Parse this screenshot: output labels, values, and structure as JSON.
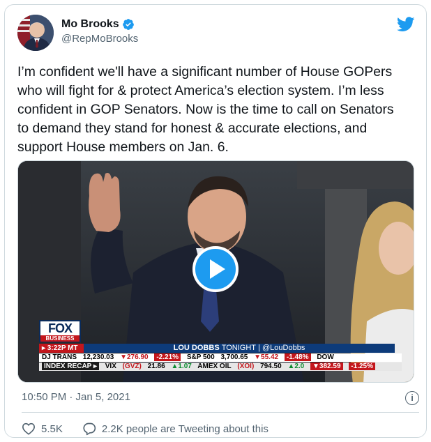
{
  "author": {
    "name": "Mo Brooks",
    "handle": "@RepMoBrooks",
    "verified": true
  },
  "tweet": {
    "text": "I’m confident we'll have a significant number of House GOPers who will fight for & protect America’s election system. I’m less confident in GOP Senators. Now is the time to call on Senators to demand they stand for honest & accurate elections, and support House members on Jan. 6.",
    "timestamp": "10:50 PM · Jan 5, 2021"
  },
  "video": {
    "chyron": {
      "logo_top": "FOX",
      "logo_bottom": "BUSINESS",
      "time": "▸ 3:22P MT",
      "show_name": "LOU DOBBS",
      "show_suffix": "TONIGHT",
      "show_handle": "@LouDobbs",
      "ticker_line1": {
        "a_label": "DJ TRANS",
        "a_value": "12,230.03",
        "a_change": "▼276.90",
        "a_pct": "-2.21%",
        "b_label": "S&P 500",
        "b_value": "3,700.65",
        "b_change": "▼55.42",
        "b_pct": "-1.48%",
        "c_label": "DOW"
      },
      "ticker_line2": {
        "recap": "INDEX RECAP ▸",
        "vix_label": "VIX",
        "vix_sym": "(GVZ)",
        "vix_value": "21.86",
        "vix_change": "▲1.07",
        "amex_label": "AMEX OIL",
        "amex_sym": "(XOI)",
        "amex_value": "794.50",
        "amex_change": "▲2.0",
        "dow_change": "▼382.59",
        "dow_pct": "-1.25%"
      }
    }
  },
  "engagement": {
    "likes": "5.5K",
    "replies_text": "2.2K people are Tweeting about this"
  },
  "colors": {
    "accent": "#1d9bf0",
    "text": "#0f1419",
    "muted": "#536471",
    "like_icon": "#536471"
  },
  "icons": {
    "brand": "twitter-bird-icon",
    "verified": "verified-badge-icon",
    "play": "play-icon",
    "info": "info-icon",
    "like": "heart-icon",
    "reply": "speech-bubble-icon"
  }
}
